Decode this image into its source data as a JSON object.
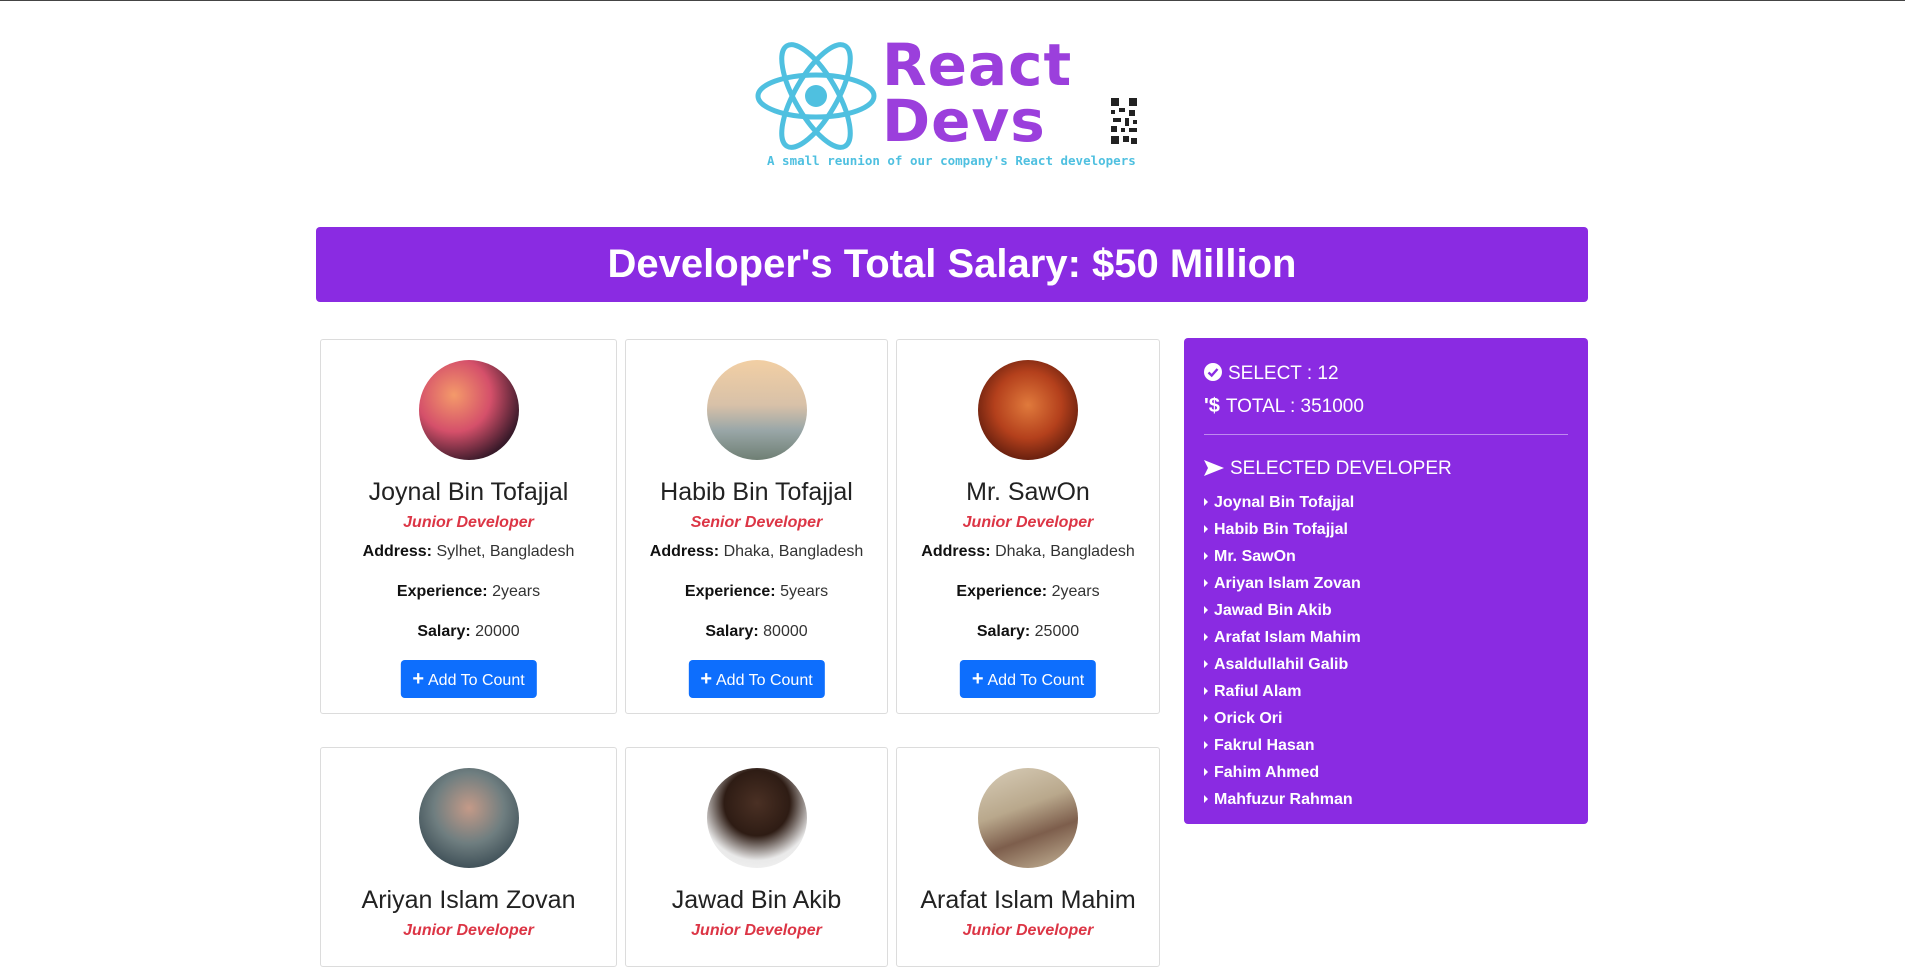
{
  "header": {
    "logo_text_line1": "React",
    "logo_text_line2": "Devs",
    "tagline": "A small reunion of our company's React developers"
  },
  "banner": {
    "title": "Developer's Total Salary: $50 Million"
  },
  "labels": {
    "address": "Address:",
    "experience": "Experience:",
    "salary": "Salary:",
    "add_button": "Add To Count"
  },
  "developers": [
    {
      "name": "Joynal Bin Tofajjal",
      "role": "Junior Developer",
      "address": "Sylhet, Bangladesh",
      "experience": "2years",
      "salary": "20000"
    },
    {
      "name": "Habib Bin Tofajjal",
      "role": "Senior Developer",
      "address": "Dhaka, Bangladesh",
      "experience": "5years",
      "salary": "80000"
    },
    {
      "name": "Mr. SawOn",
      "role": "Junior Developer",
      "address": "Dhaka, Bangladesh",
      "experience": "2years",
      "salary": "25000"
    },
    {
      "name": "Ariyan Islam Zovan",
      "role": "Junior Developer"
    },
    {
      "name": "Jawad Bin Akib",
      "role": "Junior Developer"
    },
    {
      "name": "Arafat Islam Mahim",
      "role": "Junior Developer"
    }
  ],
  "summary": {
    "select_text": "SELECT : 12",
    "total_text": "TOTAL : 351000",
    "selected_title": "SELECTED DEVELOPER",
    "selected": [
      "Joynal Bin Tofajjal",
      "Habib Bin Tofajjal",
      "Mr. SawOn",
      "Ariyan Islam Zovan",
      "Jawad Bin Akib",
      "Arafat Islam Mahim",
      "Asaldullahil Galib",
      "Rafiul Alam",
      "Orick Ori",
      "Fakrul Hasan",
      "Fahim Ahmed",
      "Mahfuzur Rahman"
    ]
  },
  "colors": {
    "accent": "#8a2be2",
    "button": "#0d6efd",
    "role": "#dc3545",
    "logo_cyan": "#4fc0e0"
  }
}
